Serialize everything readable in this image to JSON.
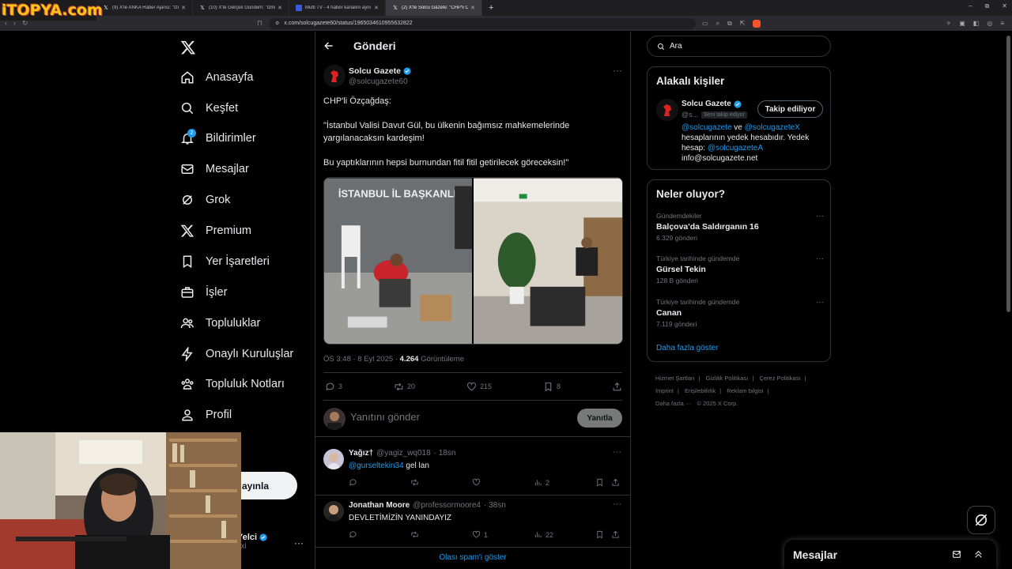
{
  "watermark": {
    "logo_text": "iTOPYA.com"
  },
  "browser": {
    "tabs": [
      {
        "label": "(9) X'te ANKA Haber Ajansı: \"İzmir Va",
        "icon": "x-icon",
        "active": false
      },
      {
        "label": "(10) X'te Gerçek Gündem: \"İzmir'de 2",
        "icon": "x-icon",
        "active": false
      },
      {
        "label": "Multi TV - 4 haber kanalını aynı e",
        "icon": "tv-icon",
        "active": false
      },
      {
        "label": "(2) X'te Solcu Gazete: \"CHP'li Öz",
        "icon": "x-icon",
        "active": true
      }
    ],
    "new_tab": "+",
    "url": "x.com/solcugazete60/status/1965034610955632822"
  },
  "sidebar": {
    "items": [
      {
        "label": "Anasayfa",
        "icon": "home-icon"
      },
      {
        "label": "Keşfet",
        "icon": "search-icon"
      },
      {
        "label": "Bildirimler",
        "icon": "bell-icon",
        "badge": "2"
      },
      {
        "label": "Mesajlar",
        "icon": "mail-icon"
      },
      {
        "label": "Grok",
        "icon": "grok-icon"
      },
      {
        "label": "Premium",
        "icon": "x-icon"
      },
      {
        "label": "Yer İşaretleri",
        "icon": "bookmark-icon"
      },
      {
        "label": "İşler",
        "icon": "briefcase-icon"
      },
      {
        "label": "Topluluklar",
        "icon": "people-icon"
      },
      {
        "label": "Onaylı Kuruluşlar",
        "icon": "lightning-icon"
      },
      {
        "label": "Topluluk Notları",
        "icon": "notes-icon"
      },
      {
        "label": "Profil",
        "icon": "person-icon"
      },
      {
        "label": "zla",
        "icon": "more-icon"
      }
    ],
    "post_button": "ayınla",
    "account": {
      "name": "Yelci",
      "handle": "lixi"
    }
  },
  "main": {
    "title": "Gönderi",
    "post": {
      "author": "Solcu Gazete",
      "handle": "@solcugazete60",
      "text_line1": "CHP'li Özçağdaş:",
      "text_line2": "\"İstanbul Valisi Davut Gül, bu ülkenin bağımsız mahkemelerinde",
      "text_line3": "yargılanacaksın kardeşim!",
      "text_line4": "Bu yaptıklarının hepsi burnundan fitil fitil getirilecek göreceksin!\"",
      "media_sign": "İSTANBUL İL BAŞKANLIĞI",
      "time": "ÖS 3:48 · 8 Eyl 2025 ·",
      "views": "4.264",
      "views_label": "Görüntüleme",
      "replies": "3",
      "reposts": "20",
      "likes": "215",
      "bookmarks": "8"
    },
    "reply_box": {
      "placeholder": "Yanıtını gönder",
      "button": "Yanıtla"
    },
    "replies": [
      {
        "name": "Yağız†",
        "handle": "@yagiz_wq018",
        "time": "· 18sn",
        "mention": "@gurseltekin34",
        "text": " gel lan",
        "reply_count": "",
        "repost_count": "",
        "like_count": "",
        "views": "2"
      },
      {
        "name": "Jonathan Moore",
        "handle": "@professormoore4",
        "time": "· 38sn",
        "mention": "",
        "text": "DEVLETİMİZİN YANINDAYIZ",
        "reply_count": "",
        "repost_count": "",
        "like_count": "1",
        "views": "22"
      }
    ],
    "show_spam": "Olası spam'i göster"
  },
  "right": {
    "search_placeholder": "Ara",
    "relevant": {
      "title": "Alakalı kişiler",
      "name": "Solcu Gazete",
      "handle": "@s...",
      "follows_you": "Seni takip ediyor",
      "follow_button": "Takip ediliyor",
      "bio_m1": "@solcugazete",
      "bio_t1": " ve ",
      "bio_m2": "@solcugazeteX",
      "bio_t2": " hesaplarının yedek hesabıdır. Yedek hesap: ",
      "bio_m3": "@solcugazeteA",
      "bio_t3": "info@solcugazete.net"
    },
    "trends": {
      "title": "Neler oluyor?",
      "items": [
        {
          "context": "Gündemdekiler",
          "name": "Balçova'da Saldırganın 16",
          "count": "6.329 gönderi"
        },
        {
          "context": "Türkiye tarihinde gündemde",
          "name": "Gürsel Tekin",
          "count": "128 B gönderi"
        },
        {
          "context": "Türkiye tarihinde gündemde",
          "name": "Canan",
          "count": "7.119 gönderi"
        }
      ],
      "show_more": "Daha fazla göster"
    },
    "footer": [
      "Hizmet Şartları",
      "|",
      "Gizlilik Politikası",
      "|",
      "Çerez Politikası",
      "|",
      "İmprint",
      "|",
      "Erişilebilirlik",
      "|",
      "Reklam bilgisi",
      "|",
      "Daha fazla ···",
      "© 2025 X Corp."
    ]
  },
  "messages_drawer": {
    "title": "Mesajlar"
  },
  "colors": {
    "accent": "#1d9bf0",
    "background": "#000000",
    "border": "#2f3336",
    "muted": "#71767b"
  }
}
